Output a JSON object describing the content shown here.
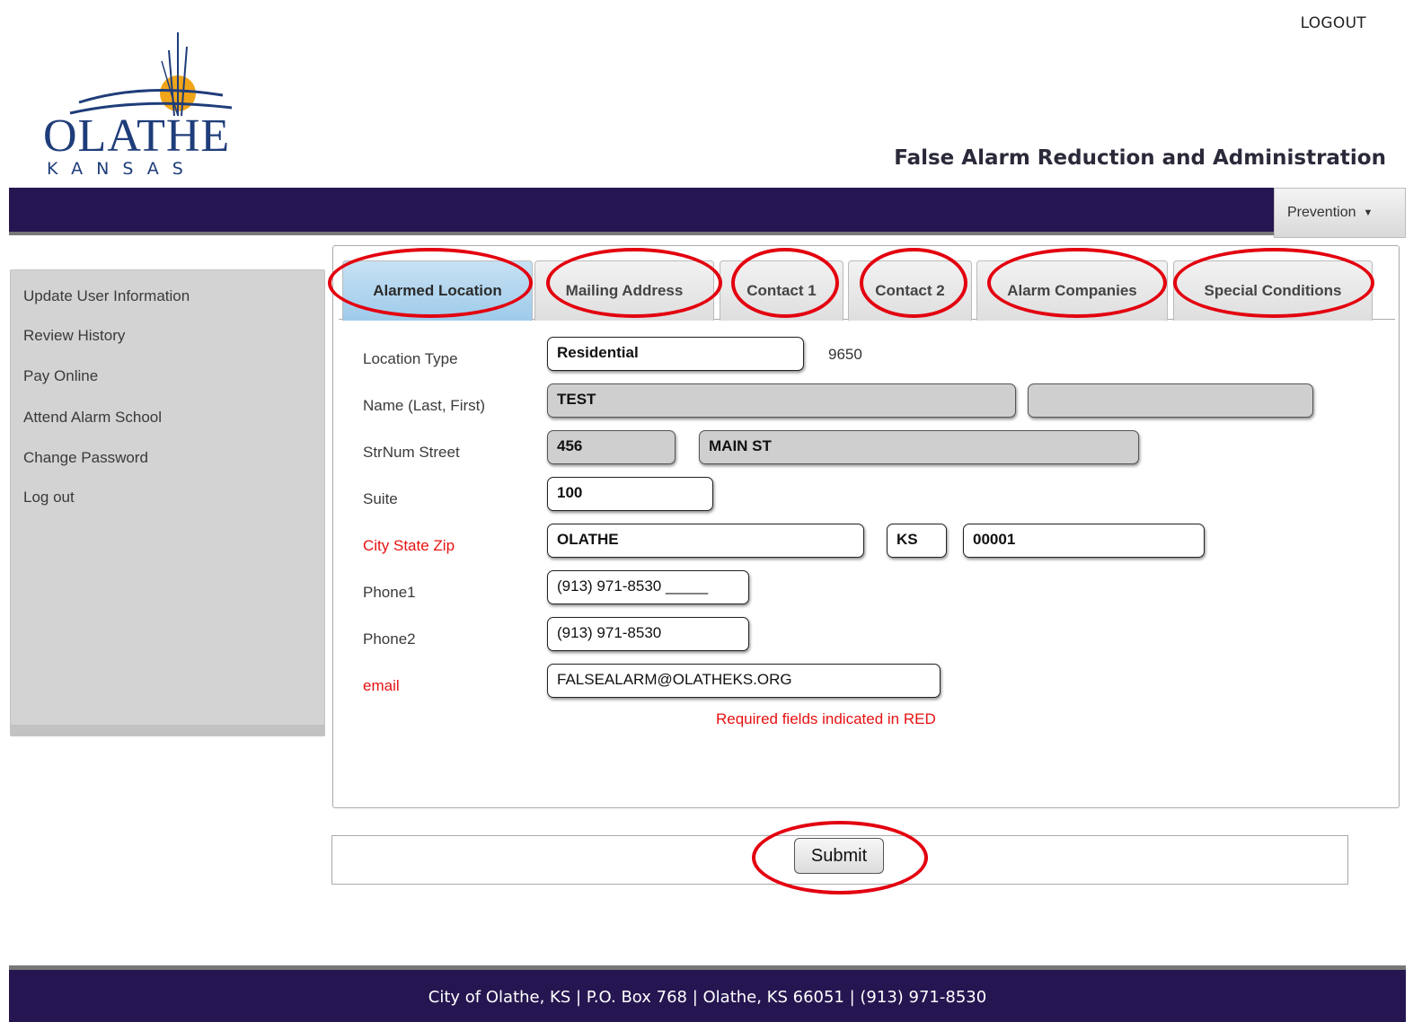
{
  "header": {
    "logout_label": "LOGOUT",
    "logo_word": "OLATHE",
    "logo_sub": "KANSAS",
    "app_title": "False Alarm Reduction and Administration"
  },
  "nav": {
    "dropdown_label": "Prevention",
    "dropdown_icon": "caret-down-icon"
  },
  "sidebar": {
    "items": [
      {
        "label": "Update User Information"
      },
      {
        "label": "Review History"
      },
      {
        "label": "Pay Online"
      },
      {
        "label": "Attend Alarm School"
      },
      {
        "label": "Change Password"
      },
      {
        "label": "Log out"
      }
    ]
  },
  "tabs": [
    {
      "label": "Alarmed Location",
      "active": true
    },
    {
      "label": "Mailing Address",
      "active": false
    },
    {
      "label": "Contact 1",
      "active": false
    },
    {
      "label": "Contact 2",
      "active": false
    },
    {
      "label": "Alarm Companies",
      "active": false
    },
    {
      "label": "Special Conditions",
      "active": false
    }
  ],
  "form": {
    "labels": {
      "location_type": "Location Type",
      "name": "Name (Last, First)",
      "street": "StrNum Street",
      "suite": "Suite",
      "city_state_zip": "City State Zip",
      "phone1": "Phone1",
      "phone2": "Phone2",
      "email": "email"
    },
    "values": {
      "location_type": "Residential",
      "location_id": "9650",
      "last_name": "TEST",
      "first_name": "",
      "street_number": "456",
      "street_name": "MAIN ST",
      "suite": "100",
      "city": "OLATHE",
      "state": "KS",
      "zip": "00001",
      "phone1": "(913) 971-8530 _____",
      "phone2": "(913) 971-8530",
      "email": "FALSEALARM@OLATHEKS.ORG"
    },
    "required_note": "Required fields indicated in RED",
    "colors": {
      "required": "#e61111",
      "annotation": "#e3000f"
    }
  },
  "submit_label": "Submit",
  "footer_text": "City of Olathe, KS | P.O. Box 768 | Olathe, KS 66051 | (913) 971-8530",
  "colors": {
    "nav_background": "#251651",
    "active_tab": "#9ecbea"
  }
}
